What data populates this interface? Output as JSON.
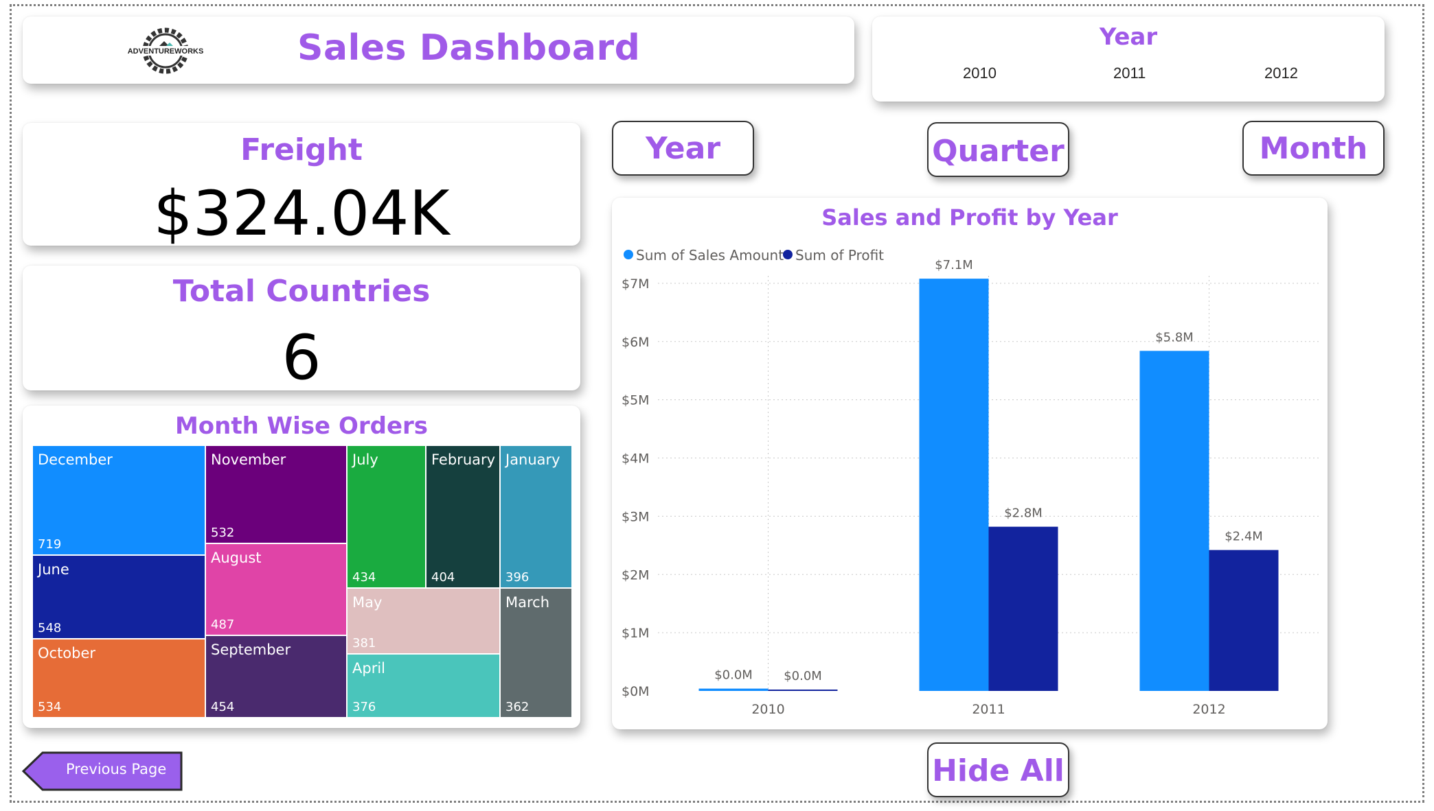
{
  "header": {
    "title": "Sales Dashboard",
    "logo_text": "ADVENTUREWORKS"
  },
  "year_slicer": {
    "title": "Year",
    "options": [
      "2010",
      "2011",
      "2012"
    ]
  },
  "kpis": {
    "freight": {
      "title": "Freight",
      "value": "$324.04K"
    },
    "countries": {
      "title": "Total Countries",
      "value": "6"
    }
  },
  "treemap": {
    "title": "Month Wise Orders",
    "tiles": [
      {
        "label": "December",
        "value": "719",
        "color": "#118dff"
      },
      {
        "label": "November",
        "value": "532",
        "color": "#6b007b"
      },
      {
        "label": "July",
        "value": "434",
        "color": "#1aab40"
      },
      {
        "label": "February",
        "value": "404",
        "color": "#15403e"
      },
      {
        "label": "January",
        "value": "396",
        "color": "#3599b8"
      },
      {
        "label": "June",
        "value": "548",
        "color": "#12239e"
      },
      {
        "label": "August",
        "value": "487",
        "color": "#e044a7"
      },
      {
        "label": "May",
        "value": "381",
        "color": "#dfbfbf"
      },
      {
        "label": "March",
        "value": "362",
        "color": "#5f6b6d"
      },
      {
        "label": "October",
        "value": "534",
        "color": "#e66c37"
      },
      {
        "label": "September",
        "value": "454",
        "color": "#4a2a6e"
      },
      {
        "label": "April",
        "value": "376",
        "color": "#4ac5bb"
      }
    ]
  },
  "buttons": {
    "year": "Year",
    "quarter": "Quarter",
    "month": "Month",
    "hide_all": "Hide All",
    "previous_page": "Previous Page"
  },
  "chart_data": {
    "type": "bar",
    "title": "Sales and Profit by Year",
    "categories": [
      "2010",
      "2011",
      "2012"
    ],
    "series": [
      {
        "name": "Sum of Sales Amount",
        "color": "#118dff",
        "values": [
          0.04,
          7.08,
          5.84
        ],
        "labels": [
          "$0.0M",
          "$7.1M",
          "$5.8M"
        ]
      },
      {
        "name": "Sum of Profit",
        "color": "#12239e",
        "values": [
          0.02,
          2.82,
          2.42
        ],
        "labels": [
          "$0.0M",
          "$2.8M",
          "$2.4M"
        ]
      }
    ],
    "ylim": [
      0,
      7.6
    ],
    "yticks": [
      "$0M",
      "$1M",
      "$2M",
      "$3M",
      "$4M",
      "$5M",
      "$6M",
      "$7M"
    ],
    "xlabel": "",
    "ylabel": "",
    "legend": "top-left",
    "grid": true
  }
}
